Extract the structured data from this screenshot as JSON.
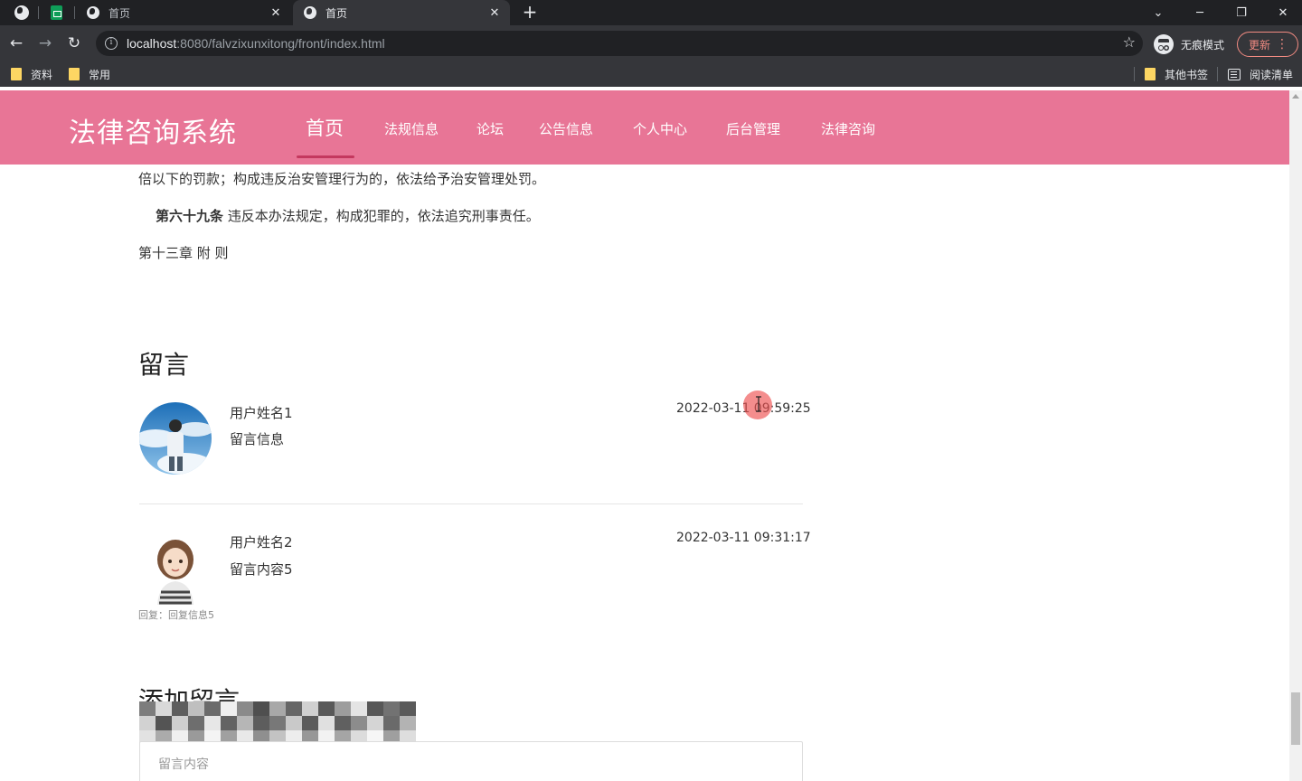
{
  "browser": {
    "tabs": [
      {
        "title": "首页",
        "active": false
      },
      {
        "title": "首页",
        "active": true
      }
    ],
    "close_glyph": "✕",
    "new_tab_glyph": "+",
    "window_controls": [
      "⌄",
      "─",
      "❐",
      "✕"
    ],
    "url_host": "localhost",
    "url_rest": ":8080/falvzixunxitong/front/index.html",
    "incognito_label": "无痕模式",
    "update_label": "更新",
    "bookmarks_left": [
      "资料",
      "常用"
    ],
    "bookmarks_right": [
      "其他书签",
      "阅读清单"
    ]
  },
  "site": {
    "brand": "法律咨询系统",
    "nav": [
      "首页",
      "法规信息",
      "论坛",
      "公告信息",
      "个人中心",
      "后台管理",
      "法律咨询"
    ],
    "active_nav": "首页",
    "accent_color": "#e87596"
  },
  "article": {
    "line1": "倍以下的罚款；构成违反治安管理行为的，依法给予治安管理处罚。",
    "article69_label": "第六十九条",
    "article69_text": " 违反本办法规定，构成犯罪的，依法追究刑事责任。",
    "chapter13": "第十三章 附 则"
  },
  "comments": {
    "title": "留言",
    "items": [
      {
        "user": "用户姓名1",
        "text": "留言信息",
        "time": "2022-03-11 09:59:25",
        "reply": ""
      },
      {
        "user": "用户姓名2",
        "text": "留言内容5",
        "time": "2022-03-11 09:31:17",
        "reply": "回复：回复信息5"
      }
    ]
  },
  "add_comment": {
    "title": "添加留言",
    "placeholder": "留言内容"
  }
}
